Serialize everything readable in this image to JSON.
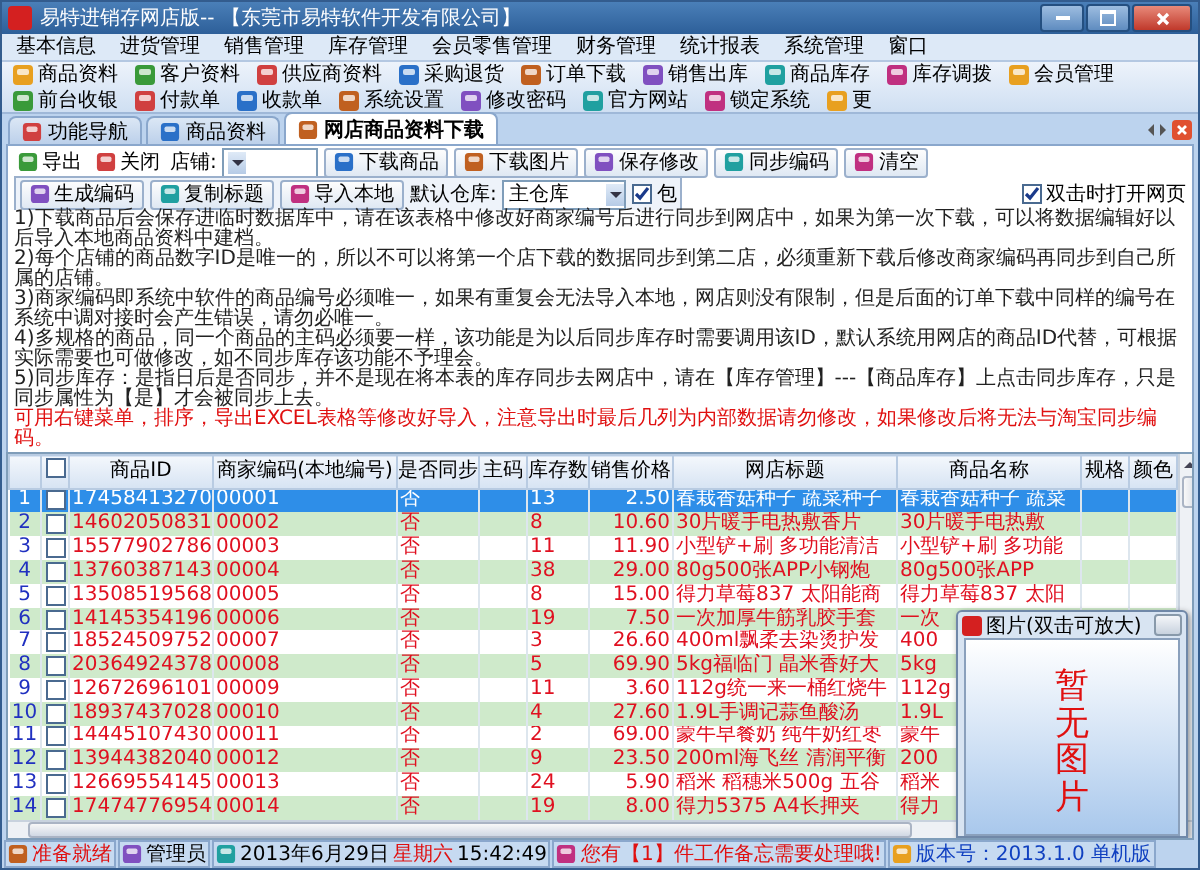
{
  "window": {
    "title": "易特进销存网店版-- 【东莞市易特软件开发有限公司】"
  },
  "menu": [
    "基本信息",
    "进货管理",
    "销售管理",
    "库存管理",
    "会员零售管理",
    "财务管理",
    "统计报表",
    "系统管理",
    "窗口"
  ],
  "toolbar": [
    "商品资料",
    "客户资料",
    "供应商资料",
    "采购退货",
    "订单下载",
    "销售出库",
    "商品库存",
    "库存调拨",
    "会员管理",
    "前台收银",
    "付款单",
    "收款单",
    "系统设置",
    "修改密码",
    "官方网站",
    "锁定系统",
    "更"
  ],
  "tabs": [
    {
      "label": "功能导航",
      "selected": false
    },
    {
      "label": "商品资料",
      "selected": false
    },
    {
      "label": "网店商品资料下载",
      "selected": true
    }
  ],
  "actions": {
    "tools": [
      "导出",
      "关闭"
    ],
    "store_label": "店铺:",
    "buttons": [
      "下载商品",
      "下载图片",
      "保存修改",
      "同步编码",
      "清空"
    ],
    "buttons_2": [
      "生成编码",
      "复制标题",
      "导入本地"
    ],
    "warehouse_label": "默认仓库:",
    "warehouse": "主仓库",
    "include": {
      "label": "包",
      "checked": true
    },
    "open_web": {
      "label": "双击时打开网页",
      "checked": true
    }
  },
  "notes": [
    {
      "kind": "info",
      "text": "1)下载商品后会保存进临时数据库中，请在该表格中修改好商家编号后进行同步到网店中，如果为第一次下载，可以将数据编辑好以后导入本地商品资料中建档。"
    },
    {
      "kind": "info",
      "text": "2)每个店铺的商品数字ID是唯一的，所以不可以将第一个店下载的数据同步到第二店，必须重新下载后修改商家编码再同步到自己所属的店铺。"
    },
    {
      "kind": "info",
      "text": "3)商家编码即系统中软件的商品编号必须唯一，如果有重复会无法导入本地，网店则没有限制，但是后面的订单下载中同样的编号在系统中调对接时会产生错误，请勿必唯一。"
    },
    {
      "kind": "info",
      "text": "4)多规格的商品，同一个商品的主码必须要一样，该功能是为以后同步库存时需要调用该ID，默认系统用网店的商品ID代替，可根据实际需要也可做修改，如不同步库存该功能不予理会。"
    },
    {
      "kind": "info",
      "text": "5)同步库存：是指日后是否同步，并不是现在将本表的库存同步去网店中，请在【库存管理】---【商品库存】上点击同步库存，只是同步属性为【是】才会被同步上去。"
    },
    {
      "kind": "warning",
      "text": "可用右键菜单，排序，导出EXCEL表格等修改好导入，注意导出时最后几列为内部数据请勿修改，如果修改后将无法与淘宝同步编码。"
    }
  ],
  "table": {
    "select_all_checked": false,
    "columns": [
      "商品ID",
      "商家编码(本地编号)",
      "是否同步",
      "主码",
      "库存数",
      "销售价格",
      "网店标题",
      "商品名称",
      "规格",
      "颜色"
    ],
    "rows": [
      {
        "num": "1",
        "selected": true,
        "checked": false,
        "id": "17458413270",
        "code": "00001",
        "sync": "否",
        "stock": "13",
        "price": "2.50",
        "title": "春栽香菇种子 蔬菜种子",
        "name": "春栽香菇种子 蔬菜"
      },
      {
        "num": "2",
        "selected": false,
        "checked": false,
        "id": "14602050831",
        "code": "00002",
        "sync": "否",
        "stock": "8",
        "price": "10.60",
        "title": "30片暖手电热敷香片",
        "name": "30片暖手电热敷"
      },
      {
        "num": "3",
        "selected": false,
        "checked": false,
        "id": "15577902786",
        "code": "00003",
        "sync": "否",
        "stock": "11",
        "price": "11.90",
        "title": "小型铲+刷 多功能清洁",
        "name": "小型铲+刷 多功能"
      },
      {
        "num": "4",
        "selected": false,
        "checked": false,
        "id": "13760387143",
        "code": "00004",
        "sync": "否",
        "stock": "38",
        "price": "29.00",
        "title": "80g500张APP小钢炮",
        "name": "80g500张APP"
      },
      {
        "num": "5",
        "selected": false,
        "checked": false,
        "id": "13508519568",
        "code": "00005",
        "sync": "否",
        "stock": "8",
        "price": "15.00",
        "title": "得力草莓837 太阳能商",
        "name": "得力草莓837 太阳"
      },
      {
        "num": "6",
        "selected": false,
        "checked": false,
        "id": "14145354196",
        "code": "00006",
        "sync": "否",
        "stock": "19",
        "price": "7.50",
        "title": "一次加厚牛筋乳胶手套",
        "name": "一次"
      },
      {
        "num": "7",
        "selected": false,
        "checked": false,
        "id": "18524509752",
        "code": "00007",
        "sync": "否",
        "stock": "3",
        "price": "26.60",
        "title": "400ml飘柔去染烫护发",
        "name": "400"
      },
      {
        "num": "8",
        "selected": false,
        "checked": false,
        "id": "20364924378",
        "code": "00008",
        "sync": "否",
        "stock": "5",
        "price": "69.90",
        "title": "5kg福临门 晶米香好大",
        "name": "5kg"
      },
      {
        "num": "9",
        "selected": false,
        "checked": false,
        "id": "12672696101",
        "code": "00009",
        "sync": "否",
        "stock": "11",
        "price": "3.60",
        "title": "112g统一来一桶红烧牛",
        "name": "112g"
      },
      {
        "num": "10",
        "selected": false,
        "checked": false,
        "id": "18937437028",
        "code": "00010",
        "sync": "否",
        "stock": "4",
        "price": "27.60",
        "title": "1.9L手调记蒜鱼酸汤",
        "name": "1.9L"
      },
      {
        "num": "11",
        "selected": false,
        "checked": false,
        "id": "14445107430",
        "code": "00011",
        "sync": "否",
        "stock": "2",
        "price": "69.00",
        "title": "蒙牛早餐奶 纯牛奶红枣",
        "name": "蒙牛"
      },
      {
        "num": "12",
        "selected": false,
        "checked": false,
        "id": "13944382040",
        "code": "00012",
        "sync": "否",
        "stock": "9",
        "price": "23.50",
        "title": "200ml海飞丝 清润平衡",
        "name": "200"
      },
      {
        "num": "13",
        "selected": false,
        "checked": false,
        "id": "12669554145",
        "code": "00013",
        "sync": "否",
        "stock": "24",
        "price": "5.90",
        "title": "稻米 稻穗米500g 五谷",
        "name": "稻米"
      },
      {
        "num": "14",
        "selected": false,
        "checked": false,
        "id": "17474776954",
        "code": "00014",
        "sync": "否",
        "stock": "19",
        "price": "8.00",
        "title": "得力5375 A4长押夹",
        "name": "得力"
      }
    ]
  },
  "popup": {
    "title": "图片(双击可放大)",
    "message": "暂无图片"
  },
  "status": [
    {
      "items": [
        {
          "kind": "alert",
          "text": "准备就绪"
        }
      ]
    },
    {
      "items": [
        {
          "kind": "normal",
          "text": "管理员"
        }
      ]
    },
    {
      "items": [
        {
          "kind": "normal",
          "text": "2013年6月29日"
        },
        {
          "kind": "alert",
          "text": "星期六"
        },
        {
          "kind": "normal",
          "text": "15:42:49"
        }
      ]
    },
    {
      "items": [
        {
          "kind": "alert",
          "text": "您有【1】件工作备忘需要处理哦!"
        }
      ]
    },
    {
      "items": [
        {
          "kind": "info",
          "text": "版本号：2013.1.0 单机版"
        }
      ]
    }
  ]
}
